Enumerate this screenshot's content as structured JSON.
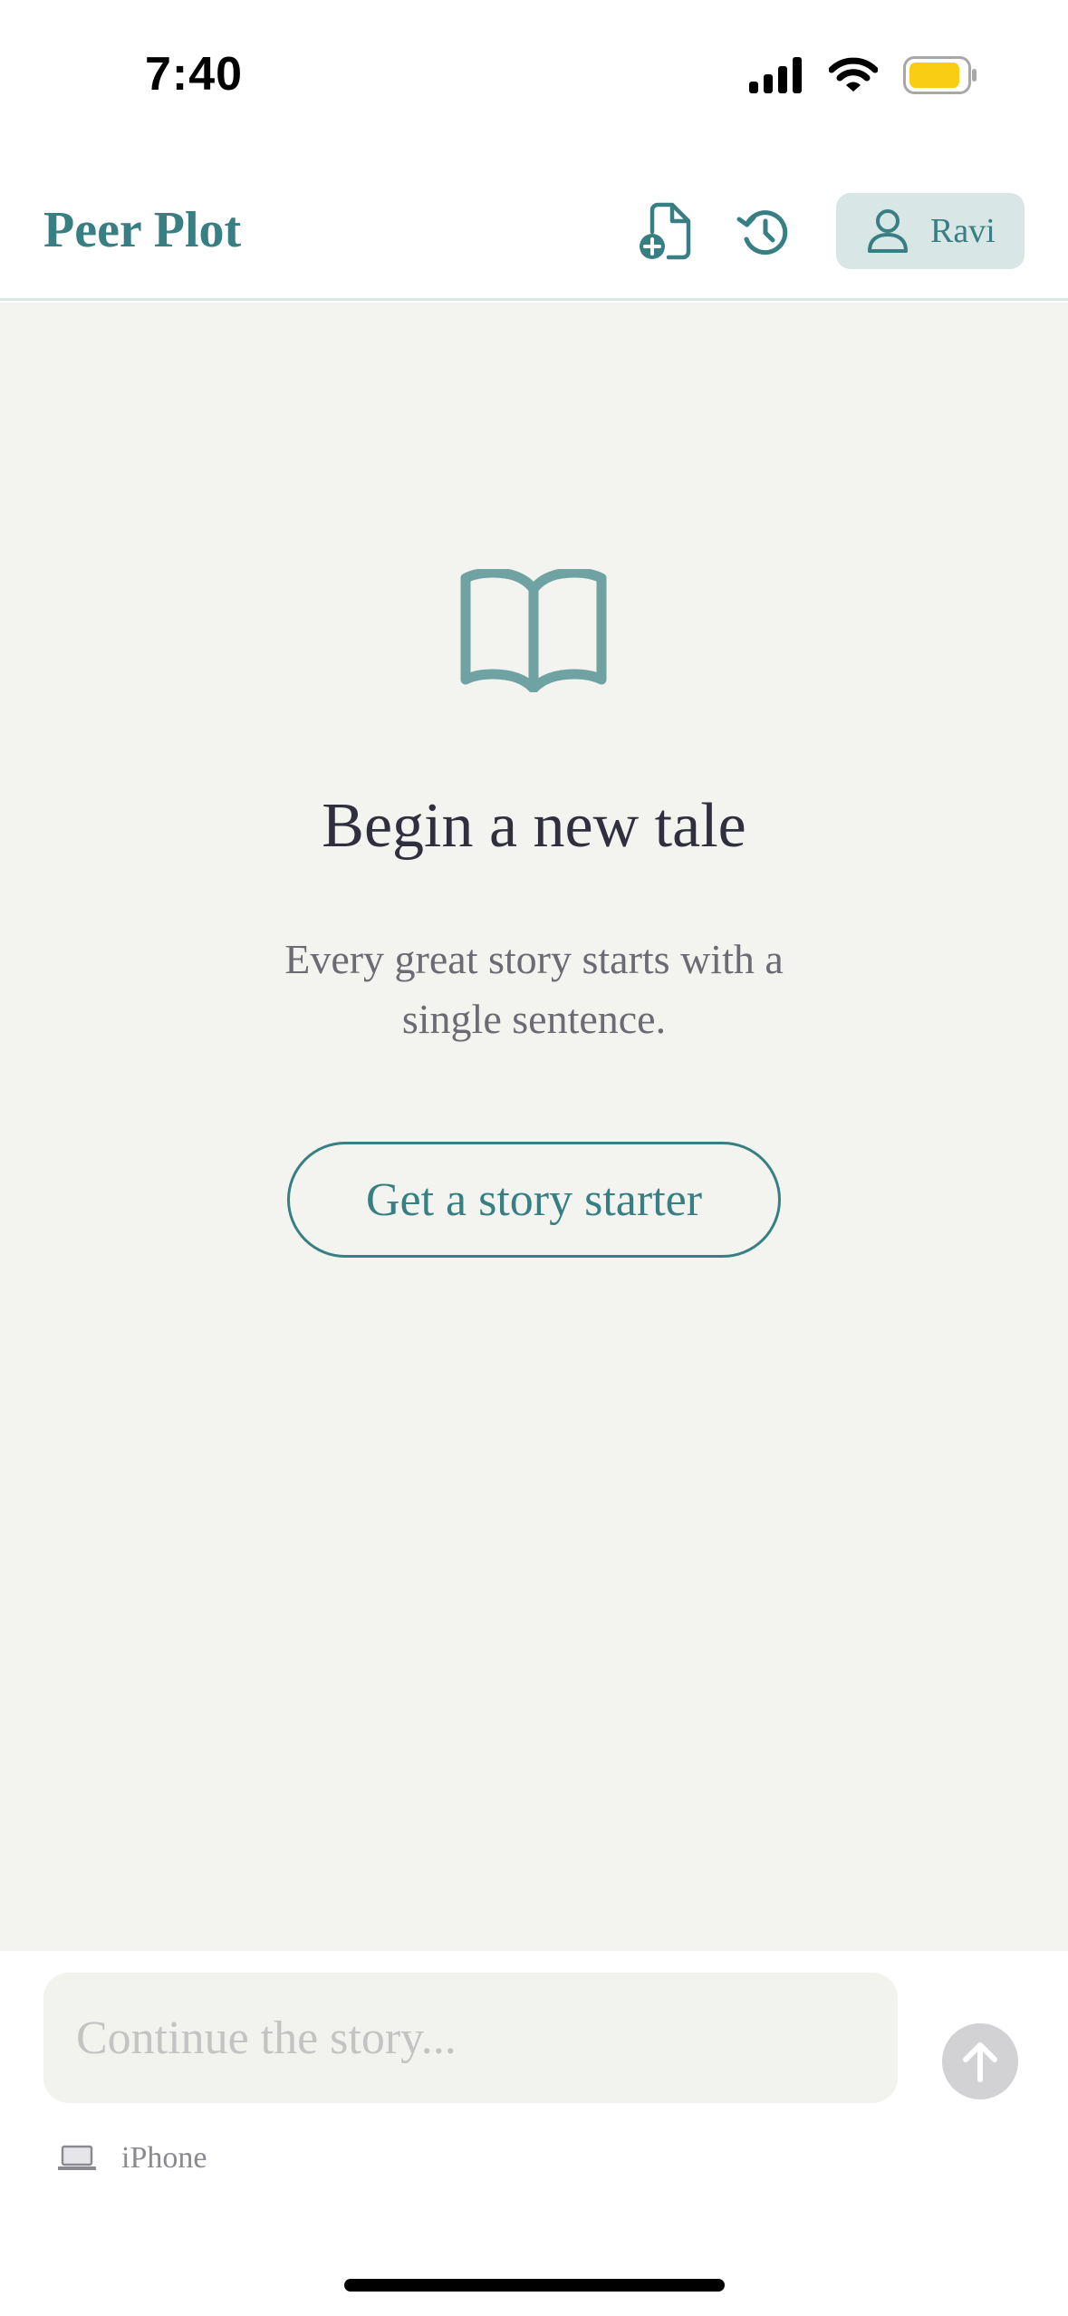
{
  "status_bar": {
    "time": "7:40",
    "icons": [
      "cellular-signal-icon",
      "wifi-icon",
      "battery-icon"
    ],
    "battery_color": "#f9cd13"
  },
  "header": {
    "title": "Peer Plot",
    "actions": [
      "new-document-icon",
      "history-icon"
    ],
    "user": {
      "name": "Ravi",
      "icon": "user-icon"
    }
  },
  "empty_state": {
    "icon": "open-book-icon",
    "title": "Begin a new tale",
    "subtitle": "Every great story starts with a single sentence.",
    "starter_button_label": "Get a story starter"
  },
  "composer": {
    "placeholder": "Continue the story...",
    "value": "",
    "send_icon": "arrow-up-icon",
    "device": {
      "icon": "laptop-icon",
      "label": "iPhone"
    }
  },
  "colors": {
    "accent": "#377f82",
    "icon_teal": "#6fa2a3",
    "background": "#f3f3ef",
    "text_dark": "#2f2f3e",
    "text_muted": "#6c6b73"
  }
}
